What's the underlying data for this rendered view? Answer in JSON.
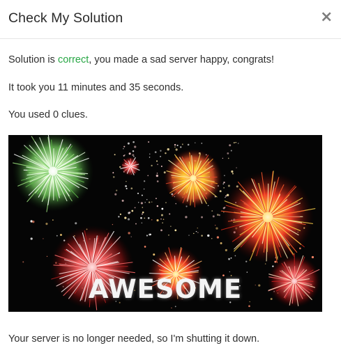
{
  "modal": {
    "title": "Check My Solution",
    "close_label": "×"
  },
  "result": {
    "prefix": "Solution is ",
    "status": "correct",
    "suffix": ", you made a sad server happy, congrats!",
    "status_color": "#28a745"
  },
  "time_line": "It took you 11 minutes and 35 seconds.",
  "clues_line": "You used 0 clues.",
  "celebration_image": {
    "caption": "AWESOME"
  },
  "shutdown_line": "Your server is no longer needed, so I'm shutting it down."
}
